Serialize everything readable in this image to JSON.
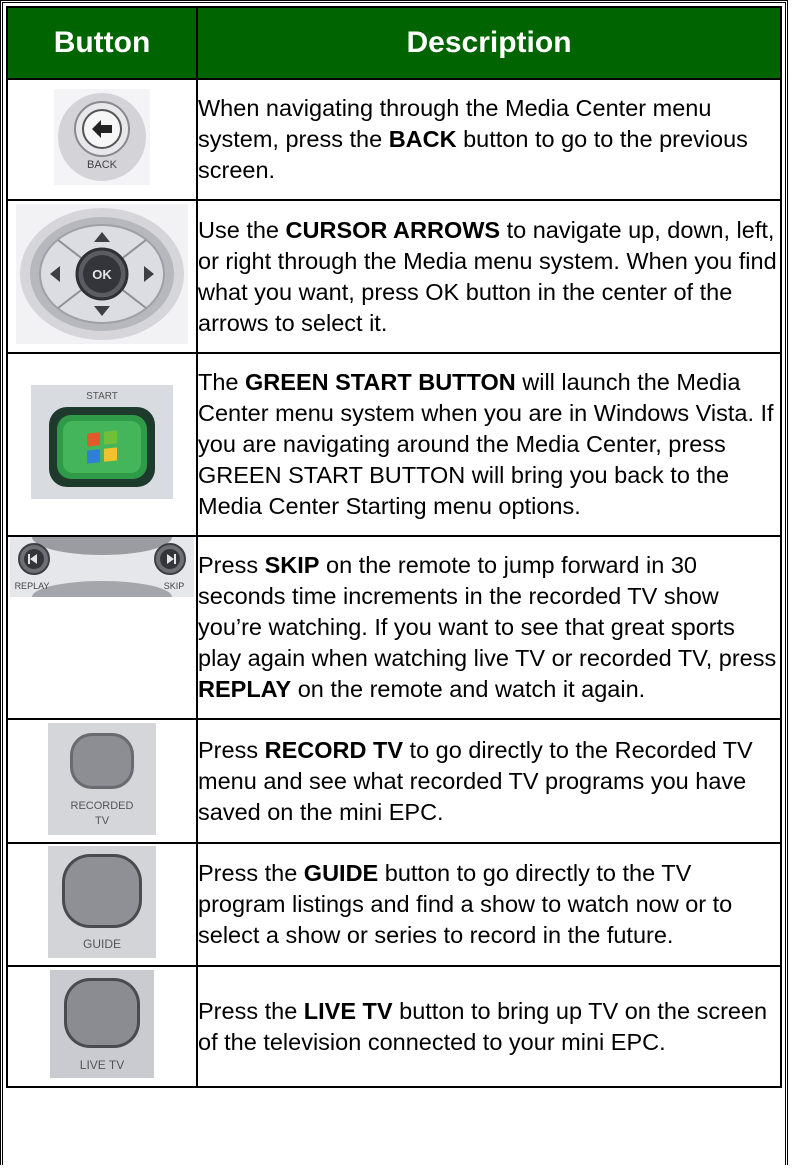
{
  "header": {
    "button_label": "Button",
    "description_label": "Description"
  },
  "rows": [
    {
      "image_caption": "BACK",
      "desc": [
        {
          "t": "When navigating through the Media Center menu system, press the "
        },
        {
          "t": "BACK",
          "b": true
        },
        {
          "t": " button to go to the previous screen."
        }
      ]
    },
    {
      "image_caption": "OK",
      "desc": [
        {
          "t": "Use the "
        },
        {
          "t": "CURSOR ARROWS",
          "b": true
        },
        {
          "t": " to navigate up, down, left, or right through the Media menu system. When you find what you want, press OK button in the center of the arrows to select it."
        }
      ]
    },
    {
      "image_caption": "START",
      "desc": [
        {
          "t": "The "
        },
        {
          "t": "GREEN START BUTTON",
          "b": true
        },
        {
          "t": " will launch the Media Center menu system when you are in Windows Vista. If you are navigating around the Media Center, press GREEN START BUTTON will bring you back to the Media Center Starting menu options."
        }
      ]
    },
    {
      "image_caption_left": "REPLAY",
      "image_caption_right": "SKIP",
      "desc": [
        {
          "t": "Press "
        },
        {
          "t": "SKIP",
          "b": true
        },
        {
          "t": " on the remote to jump forward in 30 seconds time increments in the recorded TV show you’re watching. If you want to see that great sports play again when watching live TV or recorded TV, press "
        },
        {
          "t": "REPLAY",
          "b": true
        },
        {
          "t": " on the remote and watch it again."
        }
      ]
    },
    {
      "image_caption_line1": "RECORDED",
      "image_caption_line2": "TV",
      "desc": [
        {
          "t": "Press "
        },
        {
          "t": "RECORD TV",
          "b": true
        },
        {
          "t": " to go directly to the Recorded TV menu and see what recorded TV programs you have saved on the mini EPC."
        }
      ]
    },
    {
      "image_caption": "GUIDE",
      "desc": [
        {
          "t": "Press the "
        },
        {
          "t": "GUIDE",
          "b": true
        },
        {
          "t": " button to go directly to the TV program listings and find a show to watch now or to select a show or series to record in the future."
        }
      ]
    },
    {
      "image_caption": "LIVE TV",
      "desc": [
        {
          "t": "Press the "
        },
        {
          "t": "LIVE TV",
          "b": true
        },
        {
          "t": " button to bring up TV on the screen of the television connected to your mini EPC."
        }
      ]
    }
  ]
}
